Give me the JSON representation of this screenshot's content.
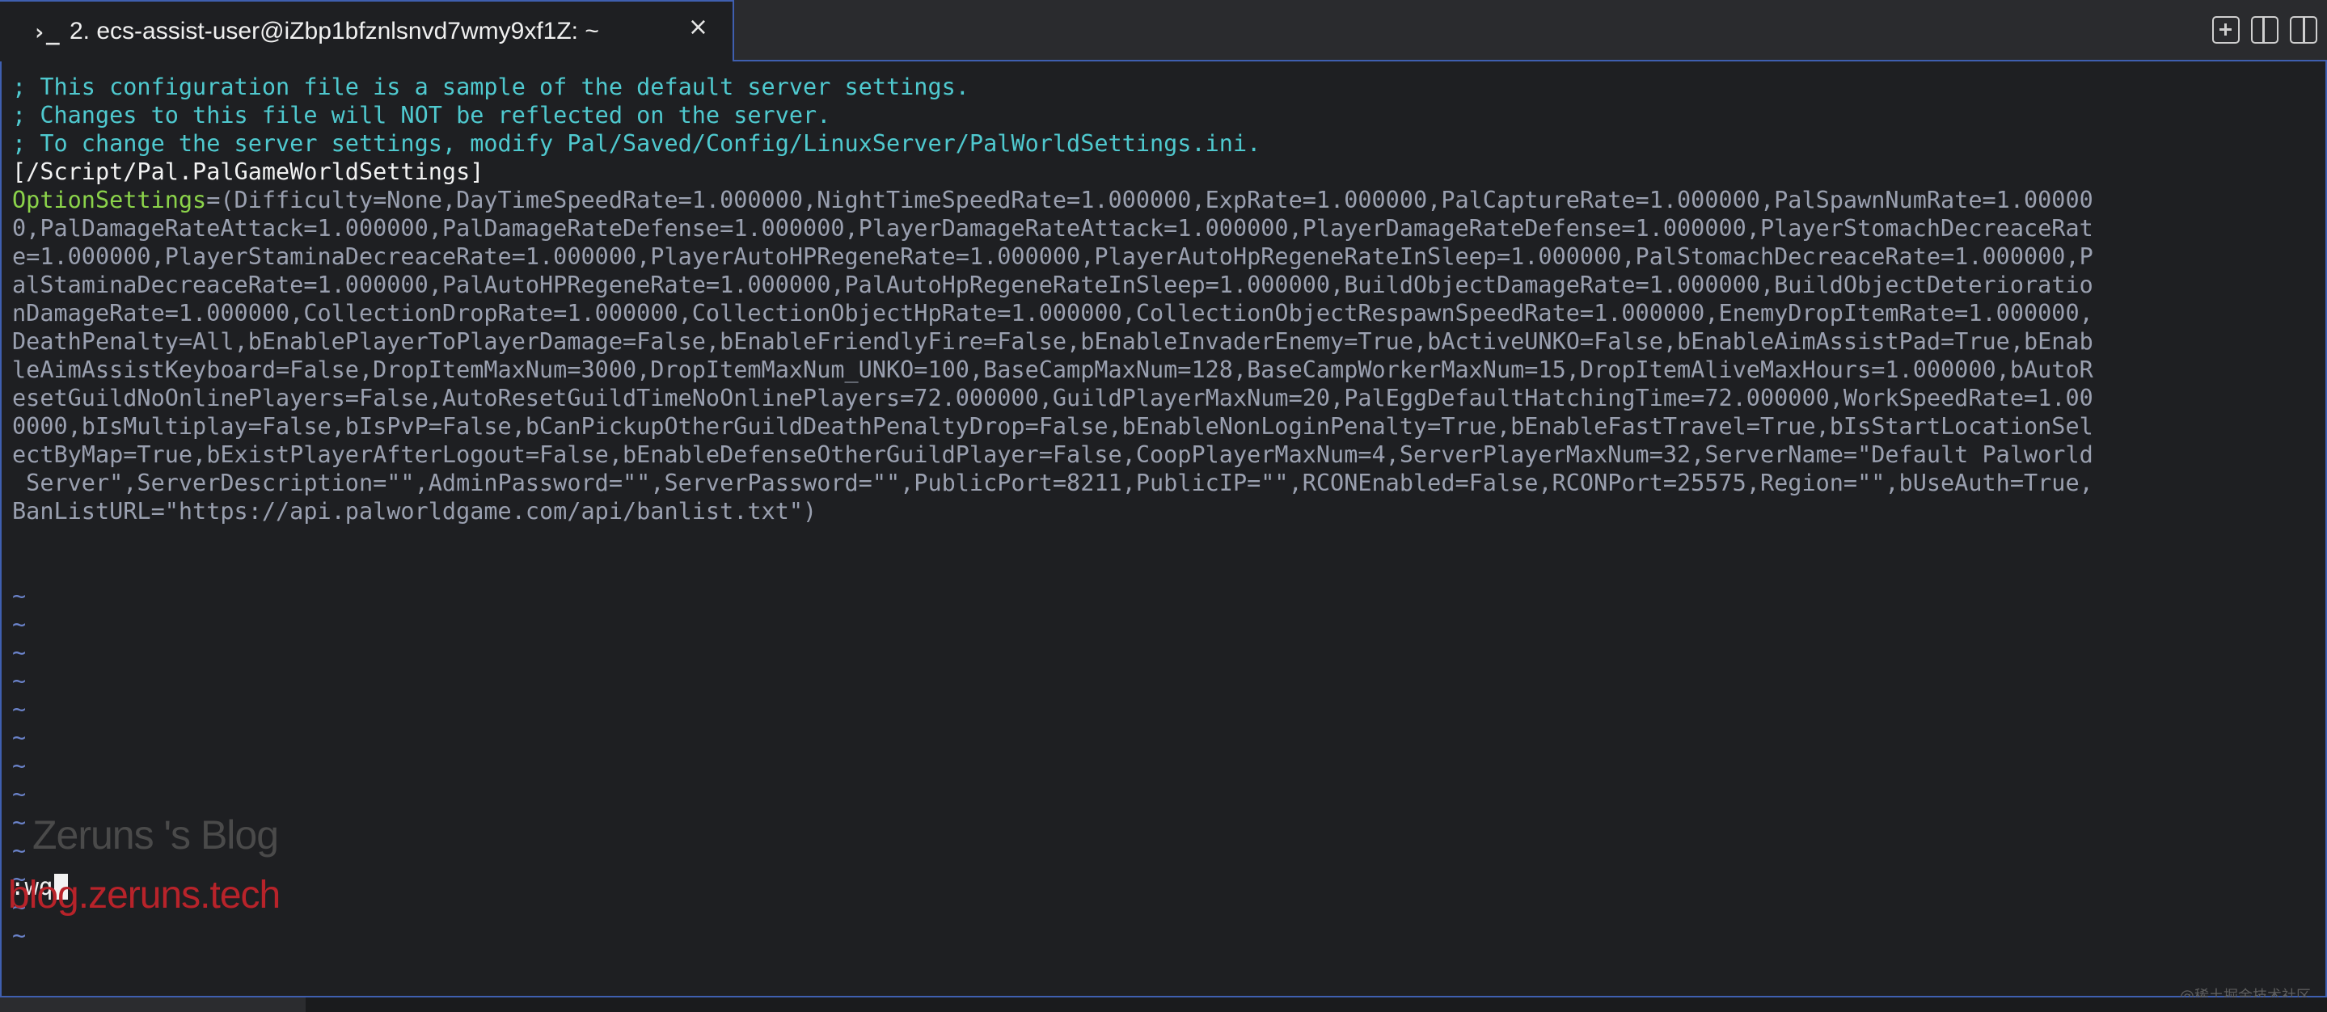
{
  "tab": {
    "prompt_icon": "›_",
    "title": "2. ecs-assist-user@iZbp1bfznlsnvd7wmy9xf1Z: ~",
    "close_glyph": "×"
  },
  "toolbar": {
    "new_tab": "new-tab-icon",
    "split_vertical": "split-vertical-icon",
    "split_horizontal": "split-horizontal-icon"
  },
  "terminal": {
    "comments": [
      "; This configuration file is a sample of the default server settings.",
      "; Changes to this file will NOT be reflected on the server.",
      "; To change the server settings, modify Pal/Saved/Config/LinuxServer/PalWorldSettings.ini."
    ],
    "section_header": "[/Script/Pal.PalGameWorldSettings]",
    "option_key": "OptionSettings",
    "option_lines": [
      "=(Difficulty=None,DayTimeSpeedRate=1.000000,NightTimeSpeedRate=1.000000,ExpRate=1.000000,PalCaptureRate=1.000000,PalSpawnNumRate=1.00000",
      "0,PalDamageRateAttack=1.000000,PalDamageRateDefense=1.000000,PlayerDamageRateAttack=1.000000,PlayerDamageRateDefense=1.000000,PlayerStomachDecreaceRat",
      "e=1.000000,PlayerStaminaDecreaceRate=1.000000,PlayerAutoHPRegeneRate=1.000000,PlayerAutoHpRegeneRateInSleep=1.000000,PalStomachDecreaceRate=1.000000,P",
      "alStaminaDecreaceRate=1.000000,PalAutoHPRegeneRate=1.000000,PalAutoHpRegeneRateInSleep=1.000000,BuildObjectDamageRate=1.000000,BuildObjectDeterioratio",
      "nDamageRate=1.000000,CollectionDropRate=1.000000,CollectionObjectHpRate=1.000000,CollectionObjectRespawnSpeedRate=1.000000,EnemyDropItemRate=1.000000,",
      "DeathPenalty=All,bEnablePlayerToPlayerDamage=False,bEnableFriendlyFire=False,bEnableInvaderEnemy=True,bActiveUNKO=False,bEnableAimAssistPad=True,bEnab",
      "leAimAssistKeyboard=False,DropItemMaxNum=3000,DropItemMaxNum_UNKO=100,BaseCampMaxNum=128,BaseCampWorkerMaxNum=15,DropItemAliveMaxHours=1.000000,bAutoR",
      "esetGuildNoOnlinePlayers=False,AutoResetGuildTimeNoOnlinePlayers=72.000000,GuildPlayerMaxNum=20,PalEggDefaultHatchingTime=72.000000,WorkSpeedRate=1.00",
      "0000,bIsMultiplay=False,bIsPvP=False,bCanPickupOtherGuildDeathPenaltyDrop=False,bEnableNonLoginPenalty=True,bEnableFastTravel=True,bIsStartLocationSel",
      "ectByMap=True,bExistPlayerAfterLogout=False,bEnableDefenseOtherGuildPlayer=False,CoopPlayerMaxNum=4,ServerPlayerMaxNum=32,ServerName=\"Default Palworld",
      " Server\",ServerDescription=\"\",AdminPassword=\"\",ServerPassword=\"\",PublicPort=8211,PublicIP=\"\",RCONEnabled=False,RCONPort=25575,Region=\"\",bUseAuth=True,",
      "BanListURL=\"https://api.palworldgame.com/api/banlist.txt\")"
    ],
    "tilde": "~",
    "command": ":wq"
  },
  "watermark": {
    "title": "Zeruns 's Blog",
    "url": "blog.zeruns.tech",
    "corner": "@稀土掘金技术社区"
  },
  "colors": {
    "comment": "#4fc9cf",
    "key": "#8bd34a",
    "value": "#9aa0b0",
    "tilde": "#6a82c9",
    "accent_border": "#3f5fb0",
    "watermark_url": "#b8232a"
  }
}
